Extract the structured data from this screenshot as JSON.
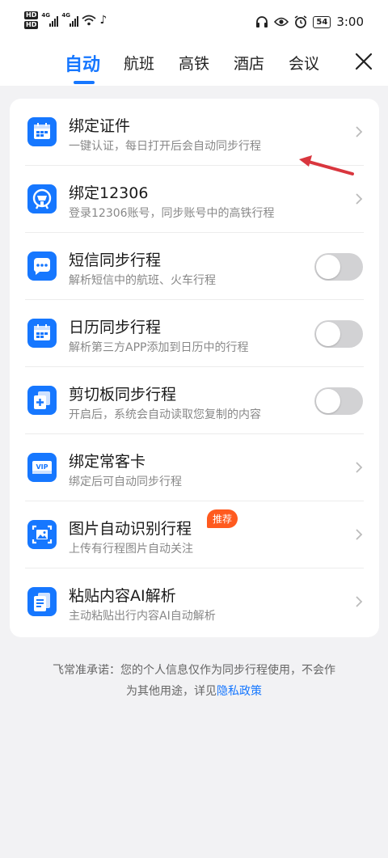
{
  "status_bar": {
    "hd1": "HD",
    "hd2": "HD",
    "net1": "4G",
    "net2": "4G",
    "battery": "54",
    "time": "3:00"
  },
  "tabs": [
    {
      "label": "自动",
      "active": true
    },
    {
      "label": "航班",
      "active": false
    },
    {
      "label": "高铁",
      "active": false
    },
    {
      "label": "酒店",
      "active": false
    },
    {
      "label": "会议",
      "active": false
    }
  ],
  "items": [
    {
      "title": "绑定证件",
      "subtitle": "一键认证，每日打开后会自动同步行程",
      "control": "chevron",
      "icon": "id-card-icon"
    },
    {
      "title": "绑定12306",
      "subtitle": "登录12306账号，同步账号中的高铁行程",
      "control": "chevron",
      "icon": "railway-icon"
    },
    {
      "title": "短信同步行程",
      "subtitle": "解析短信中的航班、火车行程",
      "control": "toggle",
      "on": false,
      "icon": "message-icon"
    },
    {
      "title": "日历同步行程",
      "subtitle": "解析第三方APP添加到日历中的行程",
      "control": "toggle",
      "on": false,
      "icon": "calendar-icon"
    },
    {
      "title": "剪切板同步行程",
      "subtitle": "开启后，系统会自动读取您复制的内容",
      "control": "toggle",
      "on": false,
      "icon": "clipboard-icon"
    },
    {
      "title": "绑定常客卡",
      "subtitle": "绑定后可自动同步行程",
      "control": "chevron",
      "icon": "vip-card-icon"
    },
    {
      "title": "图片自动识别行程",
      "subtitle": "上传有行程图片自动关注",
      "control": "chevron",
      "badge": "推荐",
      "icon": "image-scan-icon"
    },
    {
      "title": "粘贴内容AI解析",
      "subtitle": "主动粘贴出行内容AI自动解析",
      "control": "chevron",
      "icon": "paste-icon"
    }
  ],
  "footer": {
    "line1": "飞常准承诺：您的个人信息仅作为同步行程使用，不会作",
    "line2_prefix": "为其他用途，详见",
    "link": "隐私政策"
  },
  "colors": {
    "accent": "#1677ff",
    "badge": "#ff5a1f",
    "annotation_arrow": "#d9363e"
  }
}
